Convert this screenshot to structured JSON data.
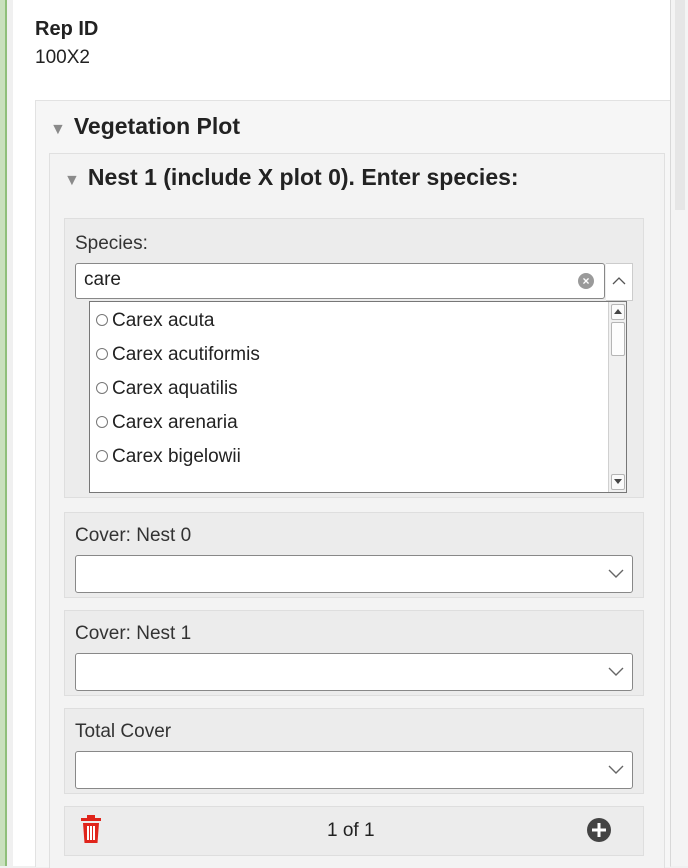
{
  "rep": {
    "label": "Rep ID",
    "value": "100X2"
  },
  "vegetation_group": {
    "title": "Vegetation Plot",
    "toggle_icon": "triangle-down-icon"
  },
  "nest_group": {
    "title": "Nest 1 (include X plot 0). Enter species:",
    "toggle_icon": "triangle-down-icon"
  },
  "species": {
    "label": "Species:",
    "search_value": "care",
    "options": [
      "Carex acuta",
      "Carex acutiformis",
      "Carex aquatilis",
      "Carex arenaria",
      "Carex bigelowii"
    ]
  },
  "cover_nest0": {
    "label": "Cover: Nest 0",
    "value": ""
  },
  "cover_nest1": {
    "label": "Cover: Nest 1",
    "value": ""
  },
  "total_cover": {
    "label": "Total Cover",
    "value": ""
  },
  "footer": {
    "pager": "1 of 1",
    "delete_icon": "trash-icon",
    "add_icon": "plus-circle-icon"
  },
  "colors": {
    "delete": "#e0241b",
    "add": "#444444",
    "accent_border": "#8fbf7a"
  }
}
